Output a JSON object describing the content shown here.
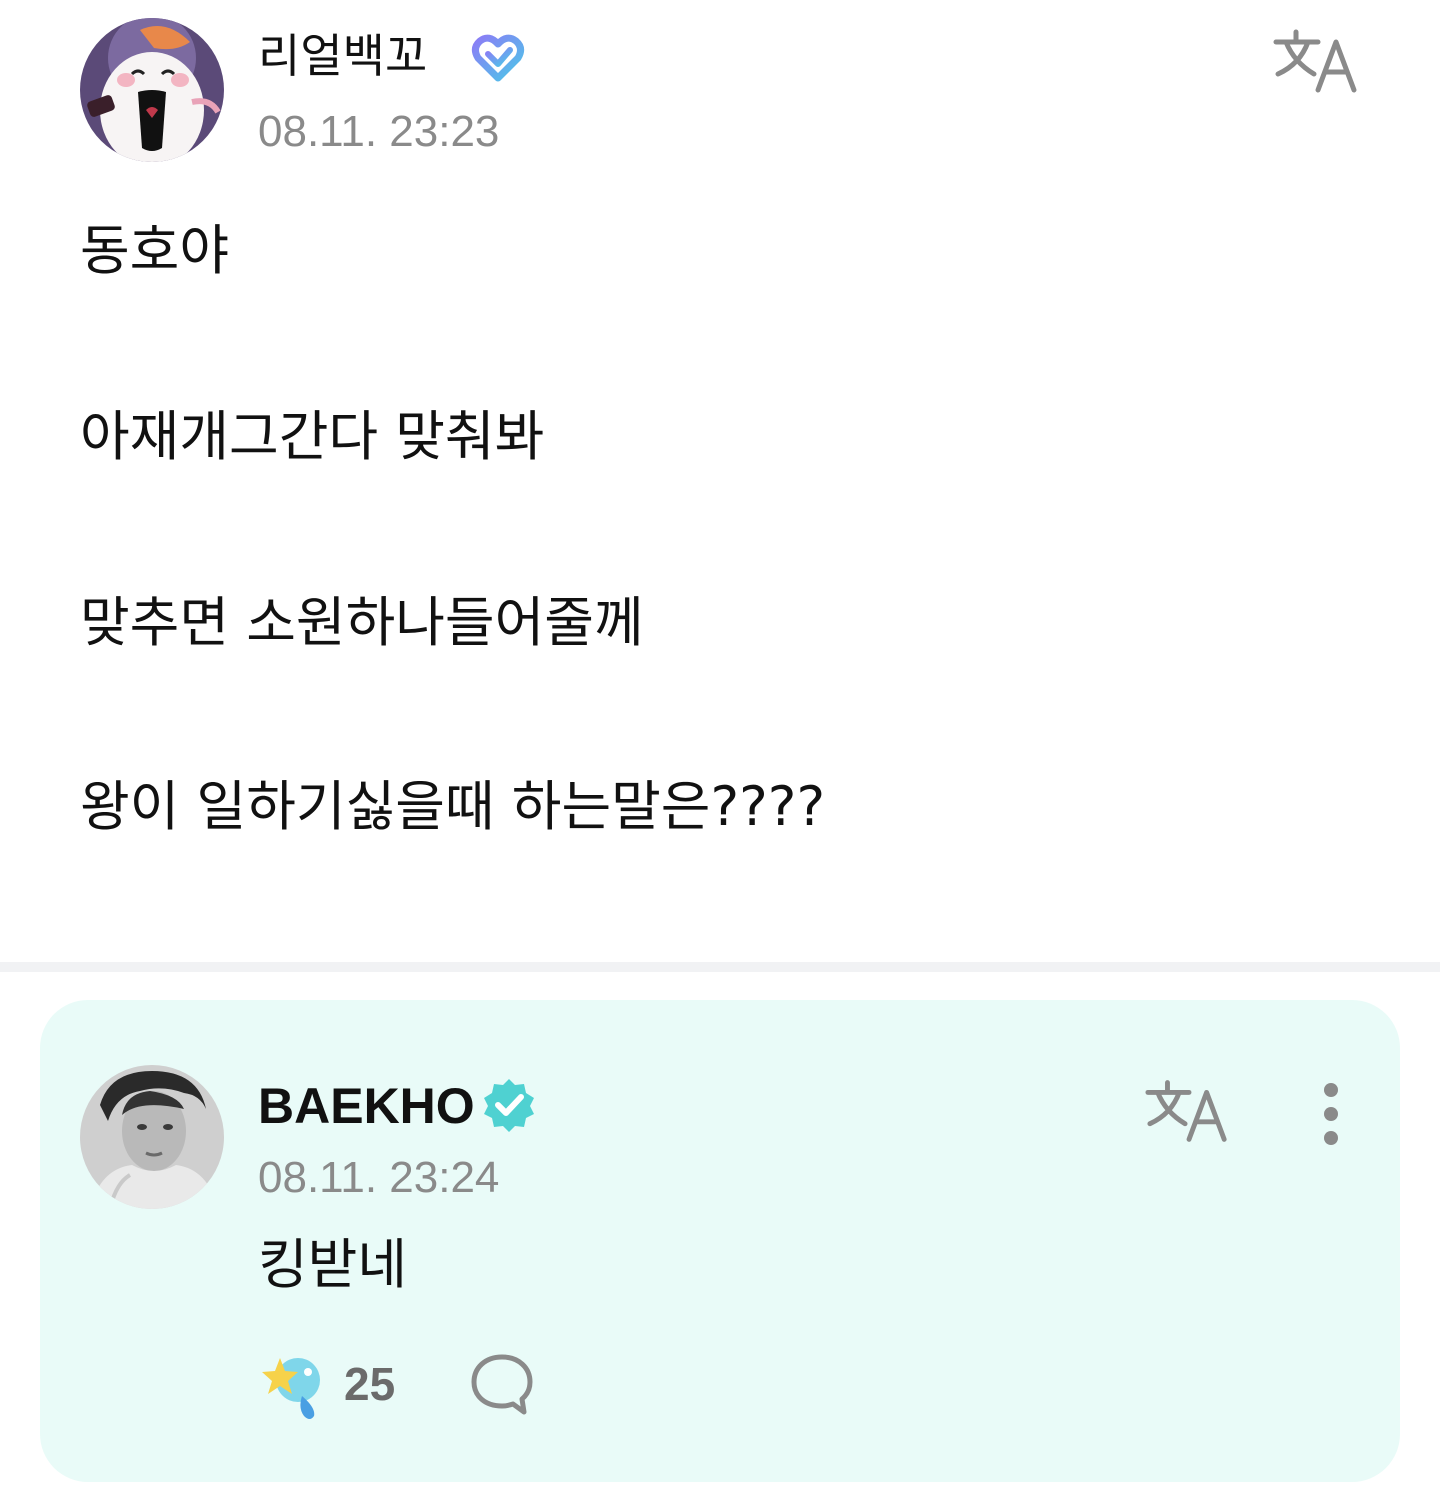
{
  "post": {
    "author": "리얼백꼬",
    "author_badge_icon": "membership-heart-icon",
    "timestamp": "08.11. 23:23",
    "translate_icon": "translate-icon",
    "lines": [
      "동호야",
      "아재개그간다 맞춰봐",
      "맞추면 소원하나들어줄께",
      "왕이 일하기싫을때 하는말은????"
    ]
  },
  "reply": {
    "author": "BAEKHO",
    "author_badge_icon": "verified-badge-icon",
    "timestamp": "08.11. 23:24",
    "text": "킹받네",
    "translate_icon": "translate-icon",
    "more_icon": "more-vertical-icon",
    "reaction_icon": "star-sparkle-icon",
    "reaction_count": "25",
    "comment_icon": "comment-bubble-icon"
  },
  "colors": {
    "reply_background": "#e9fbf8",
    "verified_badge": "#4fd1d1",
    "membership_badge_start": "#8b7cf6",
    "membership_badge_end": "#4cc7e8",
    "timestamp_gray": "#8a8a8a",
    "icon_gray": "#8a8a8a"
  }
}
